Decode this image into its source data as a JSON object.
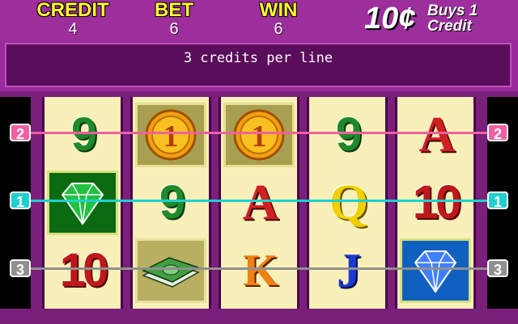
{
  "header": {
    "credit": {
      "label": "CREDIT",
      "value": "4"
    },
    "bet": {
      "label": "BET",
      "value": "6"
    },
    "win": {
      "label": "WIN",
      "value": "6"
    },
    "denomination": {
      "amount": "10¢",
      "line1": "Buys 1",
      "line2": "Credit"
    }
  },
  "message": "3 credits per line",
  "paylines": [
    {
      "number": "2",
      "color": "#f060a0"
    },
    {
      "number": "1",
      "color": "#20d0d0"
    },
    {
      "number": "3",
      "color": "#909090"
    }
  ],
  "reels": [
    [
      "9",
      "green-gem",
      "10"
    ],
    [
      "coin-1",
      "9",
      "money-stack"
    ],
    [
      "coin-1",
      "A",
      "K"
    ],
    [
      "9",
      "Q",
      "J"
    ],
    [
      "A",
      "10",
      "blue-gem"
    ]
  ],
  "symbols": {
    "nine": "9",
    "ten": "10",
    "ace": "A",
    "queen": "Q",
    "king": "K",
    "jack": "J",
    "coin": "1"
  }
}
